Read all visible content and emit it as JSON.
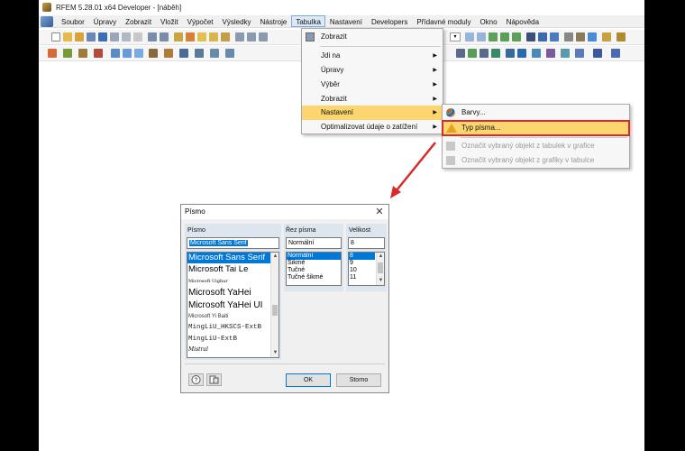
{
  "window": {
    "title": "RFEM 5.28.01 x64 Developer - [náběh]"
  },
  "menubar": {
    "items": [
      "Soubor",
      "Úpravy",
      "Zobrazit",
      "Vložit",
      "Výpočet",
      "Výsledky",
      "Nástroje",
      "Tabulka",
      "Nastavení",
      "Developers",
      "Přídavné moduly",
      "Okno",
      "Nápověda"
    ],
    "active": "Tabulka"
  },
  "tabulka_menu": {
    "items": [
      {
        "label": "Zobrazit",
        "submenu": false
      },
      {
        "label": "Jdi na",
        "submenu": true
      },
      {
        "label": "Úpravy",
        "submenu": true
      },
      {
        "label": "Výběr",
        "submenu": true
      },
      {
        "label": "Zobrazit",
        "submenu": true
      },
      {
        "label": "Nastavení",
        "submenu": true
      },
      {
        "label": "Optimalizovat údaje o zatížení",
        "submenu": true
      }
    ],
    "highlighted": "Nastavení",
    "arrow_glyph": "▶"
  },
  "nastaveni_submenu": {
    "items": [
      {
        "label": "Barvy...",
        "icon": "palette-icon",
        "disabled": false
      },
      {
        "label": "Typ písma...",
        "icon": "font-warning-icon",
        "disabled": false
      },
      {
        "label": "Označit vybraný objekt z tabulek v grafice",
        "icon": "select-to-graphic-icon",
        "disabled": true
      },
      {
        "label": "Označit vybraný objekt z grafiky v tabulce",
        "icon": "select-to-table-icon",
        "disabled": true
      }
    ],
    "highlighted": "Typ písma..."
  },
  "font_dialog": {
    "title": "Písmo",
    "close_glyph": "✕",
    "font": {
      "label": "Písmo",
      "value": "Microsoft Sans Serif",
      "options": [
        {
          "label": "Microsoft Sans Serif",
          "selected": true
        },
        {
          "label": "Microsoft Tai Le",
          "selected": false
        },
        {
          "label": "Microsoft Uighur",
          "selected": false
        },
        {
          "label": "Microsoft YaHei",
          "selected": false
        },
        {
          "label": "Microsoft YaHei UI",
          "selected": false
        },
        {
          "label": "Microsoft Yi Baiti",
          "selected": false
        },
        {
          "label": "MingLiU_HKSCS-ExtB",
          "selected": false
        },
        {
          "label": "MingLiU-ExtB",
          "selected": false
        },
        {
          "label": "Mistral",
          "selected": false
        }
      ]
    },
    "style": {
      "label": "Řez písma",
      "value": "Normální",
      "options": [
        {
          "label": "Normální",
          "selected": true
        },
        {
          "label": "Šikmé",
          "selected": false
        },
        {
          "label": "Tučné",
          "selected": false
        },
        {
          "label": "Tučné šikmé",
          "selected": false
        }
      ]
    },
    "size": {
      "label": "Velikost",
      "value": "8",
      "options": [
        {
          "label": "8",
          "selected": true
        },
        {
          "label": "9",
          "selected": false
        },
        {
          "label": "10",
          "selected": false
        },
        {
          "label": "11",
          "selected": false
        }
      ]
    },
    "buttons": {
      "ok": "OK",
      "cancel": "Storno"
    },
    "scroll_up_glyph": "▲",
    "scroll_down_glyph": "▼"
  },
  "colors": {
    "menu_highlight": "#fbd66e",
    "callout_red": "#d72b2b",
    "list_selection": "#0078d7"
  }
}
